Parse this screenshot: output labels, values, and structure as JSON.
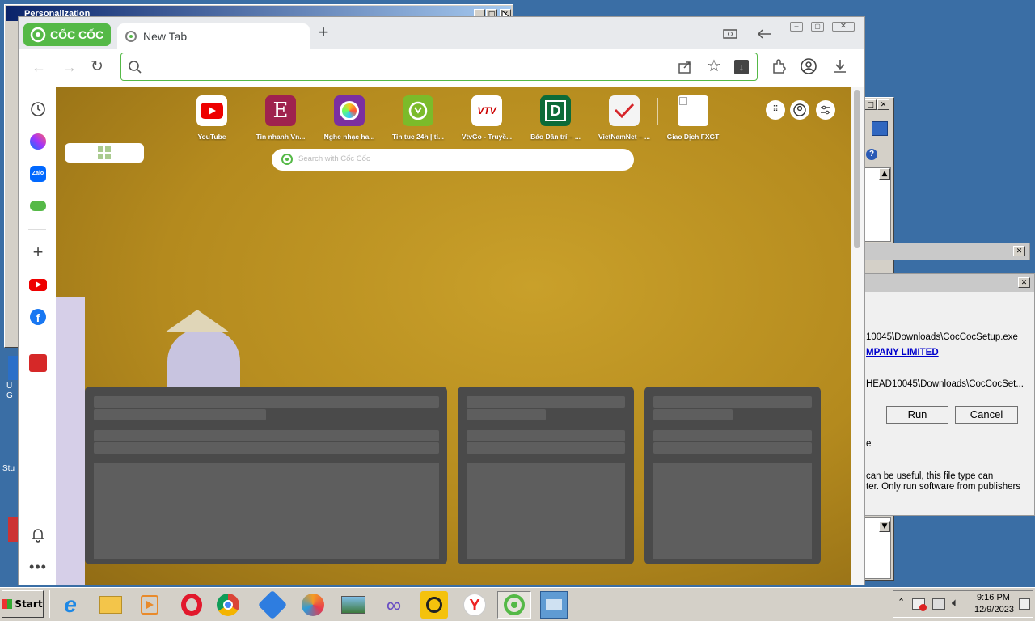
{
  "background_window": {
    "title": "Personalization"
  },
  "browser": {
    "logo": "CỐC CỐC",
    "tab_title": "New Tab",
    "new_tab_label": "+",
    "address_value": "",
    "search_placeholder": "Search with Cốc Cốc",
    "accent_color": "#55b947",
    "speed_dial": [
      {
        "label": "YouTube",
        "icon": "youtube-logo",
        "color": "#e00"
      },
      {
        "label": "Tin nhanh Vn...",
        "icon": "vnexpress-logo",
        "color": "#9f224e"
      },
      {
        "label": "Nghe nhạc ha...",
        "icon": "music-logo",
        "color": "#7b2fa0"
      },
      {
        "label": "Tin tuc 24h | ti...",
        "icon": "clock-logo",
        "color": "#7bbb2a"
      },
      {
        "label": "VtvGo - Truyề...",
        "icon": "vtvgo-logo",
        "color": "#ffffff"
      },
      {
        "label": "Báo Dân trí – ...",
        "icon": "dantri-logo",
        "color": "#0c6b38"
      },
      {
        "label": "VietNamNet – ...",
        "icon": "vietnamnet-logo",
        "color": "#f4f4f4"
      },
      {
        "label": "Giao Dịch FXGT",
        "icon": "broken-image",
        "color": "#ffffff"
      }
    ]
  },
  "dialog": {
    "line1": "10045\\Downloads\\CocCocSetup.exe",
    "publisher": "MPANY LIMITED",
    "line3": "HEAD10045\\Downloads\\CocCocSet...",
    "run_label": "Run",
    "cancel_label": "Cancel",
    "trail": "e",
    "warn1": "can be useful, this file type can",
    "warn2": "ter. Only run software from publishers"
  },
  "desktop": {
    "icon_text1": "U",
    "icon_text2": "G",
    "icon_text3": "Stu"
  },
  "taskbar": {
    "start_label": "Start",
    "time": "9:16 PM",
    "date": "12/9/2023"
  }
}
